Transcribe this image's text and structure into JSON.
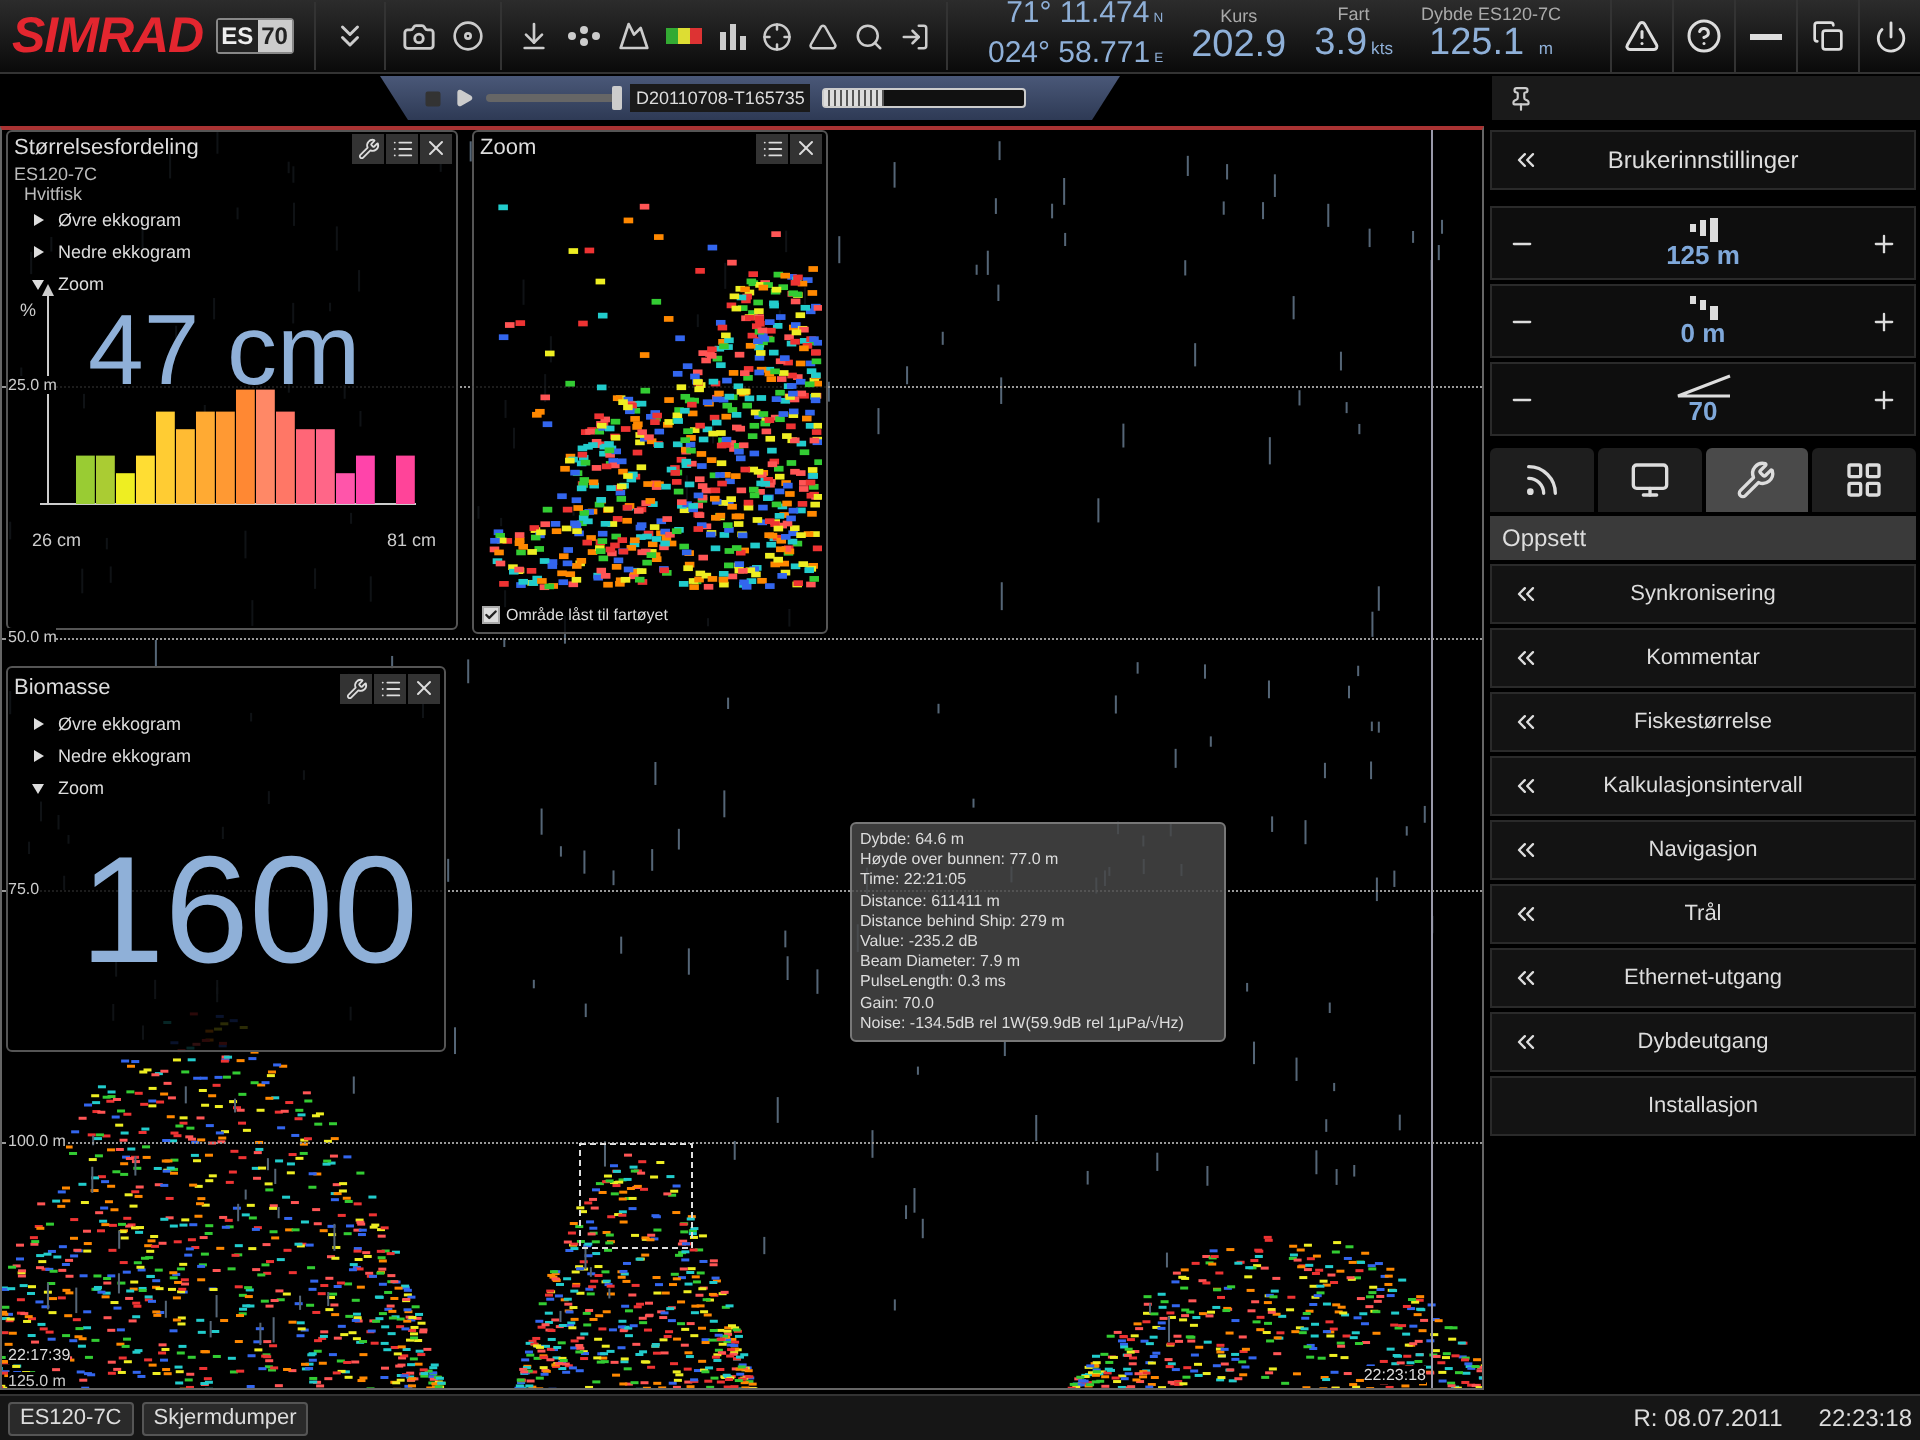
{
  "top_bar": {
    "logo": "SIMRAD",
    "model_badge": {
      "series": "ES",
      "number": "70"
    },
    "latitude": "71° 11.474$_{N}$",
    "longitude": "024° 58.771$_{E}$",
    "readouts": [
      {
        "label": "Kurs",
        "value": "202.9"
      },
      {
        "label": "Fart",
        "value": "3.9$_{kts}$"
      },
      {
        "label": "Dybde ES120-7C",
        "value": "125.1 $_{m}$"
      }
    ]
  },
  "replay_bar": {
    "file": "D20110708-T165735",
    "level": 1.0,
    "progress": {
      "level": 0.3
    }
  },
  "echogram": {
    "depth_labels": [
      "25.0 m",
      "50.0 m",
      "75.0",
      "100.0 m",
      "125.0 m"
    ],
    "start_time": "22:17:39",
    "end_time": "22:23:18"
  },
  "size_window": {
    "title": "Størrelsesfordeling",
    "transducer": "ES120-7C",
    "species": "Hvitfisk",
    "layers": [
      {
        "label": "Øvre ekkogram",
        "expanded": false
      },
      {
        "label": "Nedre ekkogram",
        "expanded": false
      },
      {
        "label": "Zoom",
        "expanded": true
      }
    ],
    "value": "47 cm",
    "axis_unit": "%",
    "min_label": "26 cm",
    "max_label": "81 cm"
  },
  "zoom_window": {
    "title": "Zoom",
    "lock": {
      "label": "Område låst til fartøyet",
      "checked": true
    }
  },
  "biomass_window": {
    "title": "Biomasse",
    "layers": [
      {
        "label": "Øvre ekkogram",
        "expanded": false
      },
      {
        "label": "Nedre ekkogram",
        "expanded": false
      },
      {
        "label": "Zoom",
        "expanded": true
      }
    ],
    "value": "1600"
  },
  "tooltip": {
    "lines": [
      "Dybde: 64.6 m",
      "Høyde over bunnen: 77.0 m",
      "Time: 22:21:05",
      "Distance: 611411 m",
      "Distance behind Ship: 279 m",
      "Value: -235.2 dB",
      "Beam Diameter: 7.9 m",
      "PulseLength: 0.3 ms",
      "Gain: 70.0",
      "Noise: -134.5dB rel 1W(59.9dB rel 1μPa/√Hz)"
    ]
  },
  "right_panel": {
    "title": "Brukerinnstillinger",
    "steppers": [
      {
        "kind": "range",
        "value": "125 m"
      },
      {
        "kind": "start",
        "value": "0 m"
      },
      {
        "kind": "gain",
        "value": "70"
      }
    ],
    "tabs": [
      {
        "kind": "echo",
        "selected": false
      },
      {
        "kind": "display",
        "selected": false
      },
      {
        "kind": "setup",
        "selected": true
      },
      {
        "kind": "windows",
        "selected": false
      }
    ],
    "section": "Oppsett",
    "menu": [
      {
        "label": "Synkronisering",
        "chevron": true
      },
      {
        "label": "Kommentar",
        "chevron": true
      },
      {
        "label": "Fiskestørrelse",
        "chevron": true
      },
      {
        "label": "Kalkulasjonsintervall",
        "chevron": true
      },
      {
        "label": "Navigasjon",
        "chevron": true
      },
      {
        "label": "Trål",
        "chevron": true
      },
      {
        "label": "Ethernet-utgang",
        "chevron": true
      },
      {
        "label": "Dybdeutgang",
        "chevron": true
      },
      {
        "label": "Installasjon",
        "chevron": false
      }
    ]
  },
  "status_bar": {
    "buttons": [
      "ES120-7C",
      "Skjermdumper"
    ],
    "date": "R: 08.07.2011",
    "time": "22:23:18"
  }
}
